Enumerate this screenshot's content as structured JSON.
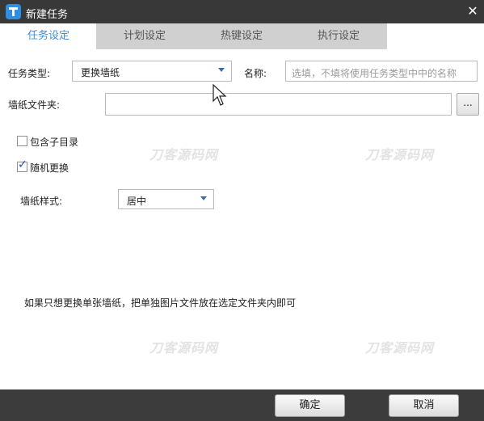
{
  "window": {
    "title": "新建任务",
    "close_symbol": "✕"
  },
  "tabs": [
    {
      "label": "任务设定",
      "active": true
    },
    {
      "label": "计划设定",
      "active": false
    },
    {
      "label": "热键设定",
      "active": false
    },
    {
      "label": "执行设定",
      "active": false
    }
  ],
  "form": {
    "task_type_label": "任务类型:",
    "task_type_value": "更换墙纸",
    "name_label": "名称:",
    "name_placeholder": "选填，不填将使用任务类型中中的名称",
    "folder_label": "墙纸文件夹:",
    "folder_value": "",
    "browse_label": "...",
    "include_subdirs_label": "包含子目录",
    "include_subdirs_checked": false,
    "random_label": "随机更换",
    "random_checked": true,
    "style_label": "墙纸样式:",
    "style_value": "居中"
  },
  "hint": "如果只想更换单张墙纸，把单独图片文件放在选定文件夹内即可",
  "watermark": "刀客源码网",
  "buttons": {
    "ok": "确定",
    "cancel": "取消"
  },
  "colors": {
    "titlebar": "#383838",
    "active_tab": "#3d8fd8",
    "footer": "#3c3c3c"
  }
}
